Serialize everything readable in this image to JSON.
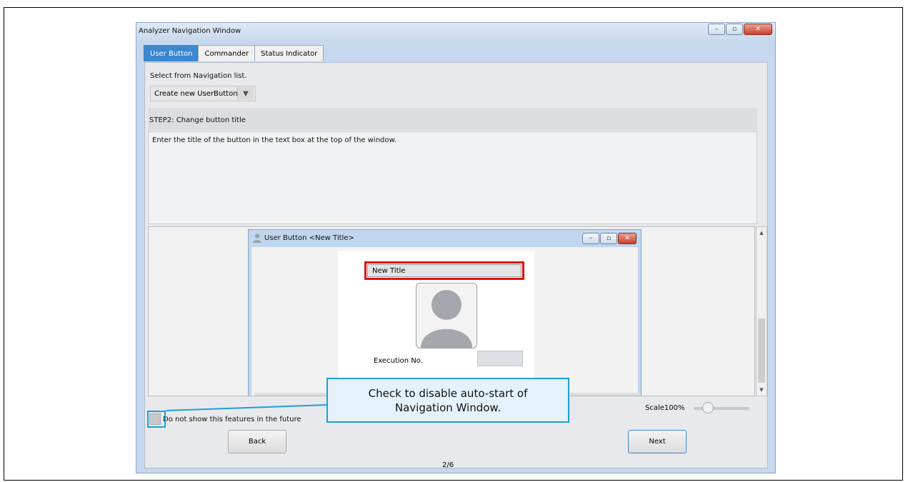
{
  "window": {
    "title": "Analyzer Navigation Window",
    "minimize": "–",
    "maximize": "▫",
    "close": "✕"
  },
  "tabs": [
    {
      "label": "User Button",
      "active": true
    },
    {
      "label": "Commander",
      "active": false
    },
    {
      "label": "Status Indicator",
      "active": false
    }
  ],
  "navigation": {
    "select_label": "Select from Navigation list.",
    "selected": "Create new UserButton"
  },
  "step": {
    "title": "STEP2: Change button title",
    "description": "Enter the title of the button in the text box at the top of the window."
  },
  "preview": {
    "window_title": "User Button <New Title>",
    "title_value": "New Title",
    "execution_label": "Execution No."
  },
  "scale": {
    "label": "Scale100%",
    "value": 1.0
  },
  "footer": {
    "checkbox_label": "Do not show this features in the future",
    "back": "Back",
    "page_indicator": "2/6",
    "next": "Next"
  },
  "callout": {
    "line1": "Check to disable auto-start of",
    "line2": "Navigation Window."
  },
  "colors": {
    "accent": "#3c87d0",
    "highlight_red": "#e01010",
    "callout_border": "#1d9fd8",
    "callout_bg": "#e4f2fb"
  }
}
